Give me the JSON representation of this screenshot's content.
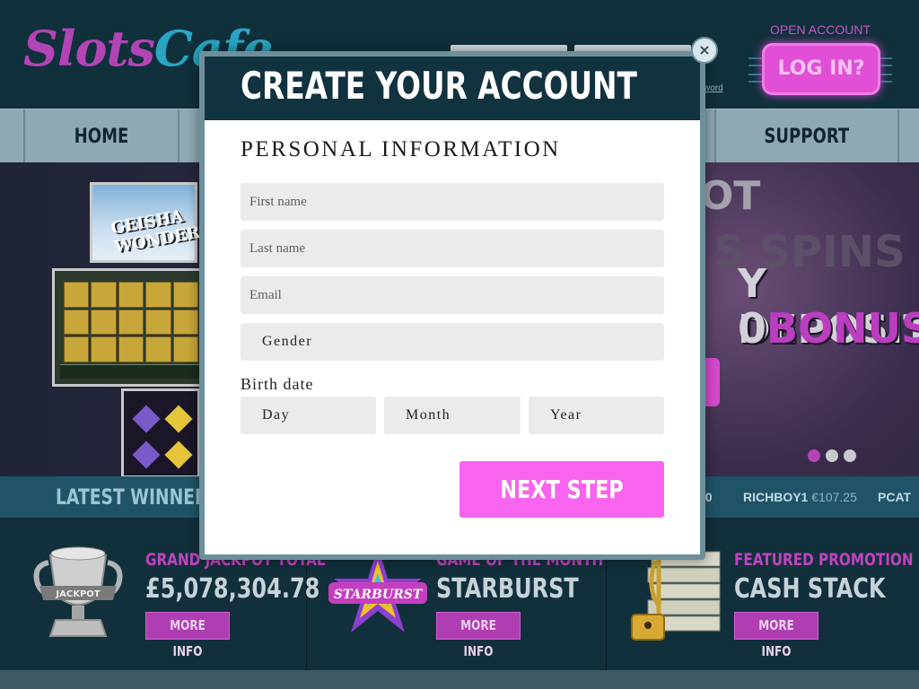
{
  "header": {
    "logo_part1": "Slots",
    "logo_part2": "Cafe",
    "forgot_password": "word",
    "open_account": "OPEN ACCOUNT",
    "login_label": "LOG IN?"
  },
  "nav": {
    "items": [
      {
        "label": "HOME"
      },
      {
        "label": "SUPPORT"
      }
    ]
  },
  "hero": {
    "line1": "OT",
    "line2": "S SPINS",
    "line3": "Y DEPOSIT",
    "line4_prefix": "0",
    "line4": "BONUS!",
    "game_title": "GEISHA WONDER",
    "slide_count": 3,
    "active_slide": 1
  },
  "winners": {
    "title": "LATEST WINNERS",
    "entries": [
      {
        "name": "00",
        "amount": ""
      },
      {
        "name": "RICHBOY1",
        "amount": "€107.25"
      },
      {
        "name": "PCAT",
        "amount": ""
      }
    ]
  },
  "promos": [
    {
      "label": "GRAND JACKPOT TOTAL",
      "value": "£5,078,304.78",
      "button": "MORE INFO",
      "art": "jackpot-trophy",
      "art_text": "JACKPOT"
    },
    {
      "label": "GAME OF THE MONTH",
      "value": "STARBURST",
      "button": "MORE INFO",
      "art": "starburst-logo",
      "art_text": "STARBURST"
    },
    {
      "label": "FEATURED PROMOTION",
      "value": "CASH STACK",
      "button": "MORE INFO",
      "art": "cash-stack"
    }
  ],
  "modal": {
    "title": "CREATE YOUR ACCOUNT",
    "close_label": "×",
    "section_title": "PERSONAL INFORMATION",
    "fields": {
      "first_name": {
        "placeholder": "First name",
        "value": ""
      },
      "last_name": {
        "placeholder": "Last name",
        "value": ""
      },
      "email": {
        "placeholder": "Email",
        "value": ""
      }
    },
    "gender_label": "Gender",
    "birth_date_label": "Birth date",
    "day_label": "Day",
    "month_label": "Month",
    "year_label": "Year",
    "next_button": "NEXT STEP"
  },
  "colors": {
    "brand_pink": "#f864ee",
    "brand_purple": "#b344b6",
    "header_navy": "#11323f",
    "frame_blue": "#6d8f9b"
  }
}
